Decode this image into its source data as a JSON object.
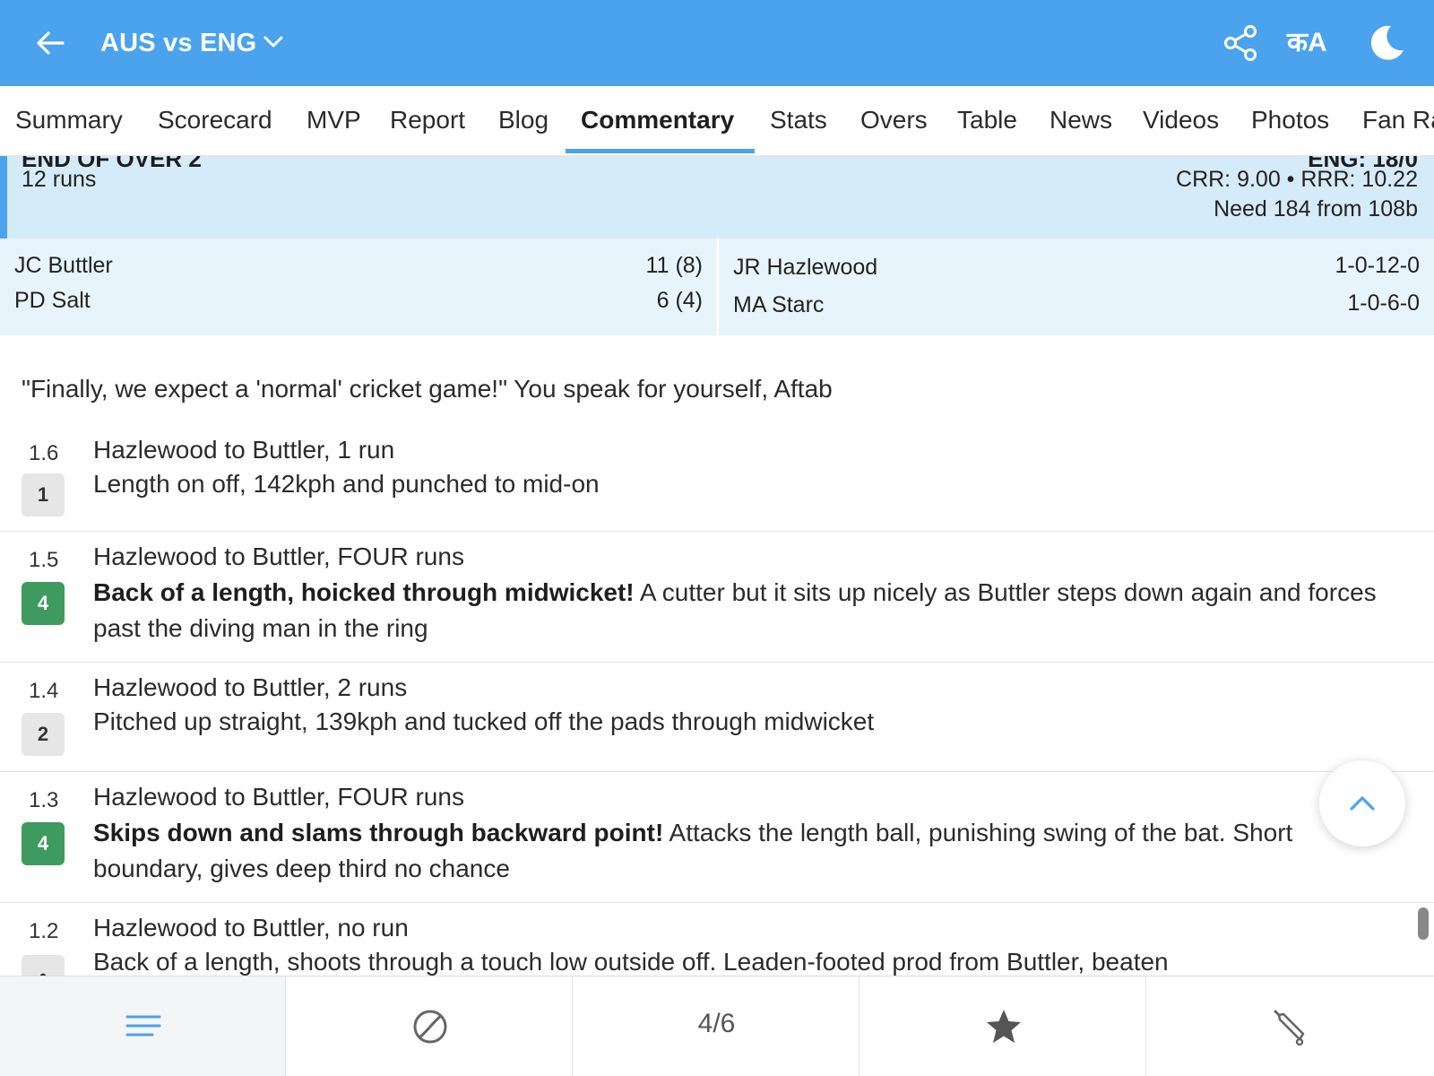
{
  "header": {
    "title": "AUS vs ENG",
    "lang_label": "कA",
    "back_icon": "back-arrow-icon",
    "share_icon": "share-icon",
    "theme_icon": "moon-icon",
    "bg_color": "#4aa3ec"
  },
  "tabs": [
    {
      "label": "Summary"
    },
    {
      "label": "Scorecard"
    },
    {
      "label": "MVP"
    },
    {
      "label": "Report"
    },
    {
      "label": "Blog"
    },
    {
      "label": "Commentary"
    },
    {
      "label": "Stats"
    },
    {
      "label": "Overs"
    },
    {
      "label": "Table"
    },
    {
      "label": "News"
    },
    {
      "label": "Videos"
    },
    {
      "label": "Photos"
    },
    {
      "label": "Fan Ra"
    }
  ],
  "over_summary": {
    "title_partial": "END OF OVER 2",
    "score_partial": "ENG: 18/0",
    "runs": "12 runs",
    "rates": "CRR: 9.00 • RRR: 10.22",
    "need": "Need 184 from 108b",
    "batters": [
      {
        "name": "JC Buttler",
        "score": "11 (8)"
      },
      {
        "name": "PD Salt",
        "score": "6 (4)"
      }
    ],
    "bowlers": [
      {
        "name": "JR Hazlewood",
        "figures": "1-0-12-0"
      },
      {
        "name": "MA Starc",
        "figures": "1-0-6-0"
      }
    ]
  },
  "commentary": {
    "note": "\"Finally, we expect a 'normal' cricket game!\" You speak for yourself, Aftab",
    "balls": [
      {
        "over": "1.6",
        "result": "1",
        "head": "Hazlewood to Buttler, 1 run",
        "bold": "",
        "text": "Length on off, 142kph and punched to mid-on"
      },
      {
        "over": "1.5",
        "result": "4",
        "head": "Hazlewood to Buttler, FOUR runs",
        "bold": "Back of a length, hoicked through midwicket!",
        "text": " A cutter but it sits up nicely as Buttler steps down again and forces past the diving man in the ring"
      },
      {
        "over": "1.4",
        "result": "2",
        "head": "Hazlewood to Buttler, 2 runs",
        "bold": "",
        "text": "Pitched up straight, 139kph and tucked off the pads through midwicket"
      },
      {
        "over": "1.3",
        "result": "4",
        "head": "Hazlewood to Buttler, FOUR runs",
        "bold": "Skips down and slams through backward point!",
        "text": " Attacks the length ball, punishing swing of the bat. Short boundary, gives deep third no chance"
      },
      {
        "over": "1.2",
        "result": "•",
        "head": "Hazlewood to Buttler, no run",
        "bold": "",
        "text": "Back of a length, shoots through a touch low outside off. Leaden-footed prod from Buttler, beaten"
      }
    ]
  },
  "bottom_nav": {
    "page_indicator": "4/6",
    "items": [
      "menu-icon",
      "ball-icon",
      "page-indicator",
      "star-icon",
      "bat-icon"
    ],
    "accent_color": "#4aa3ec"
  }
}
